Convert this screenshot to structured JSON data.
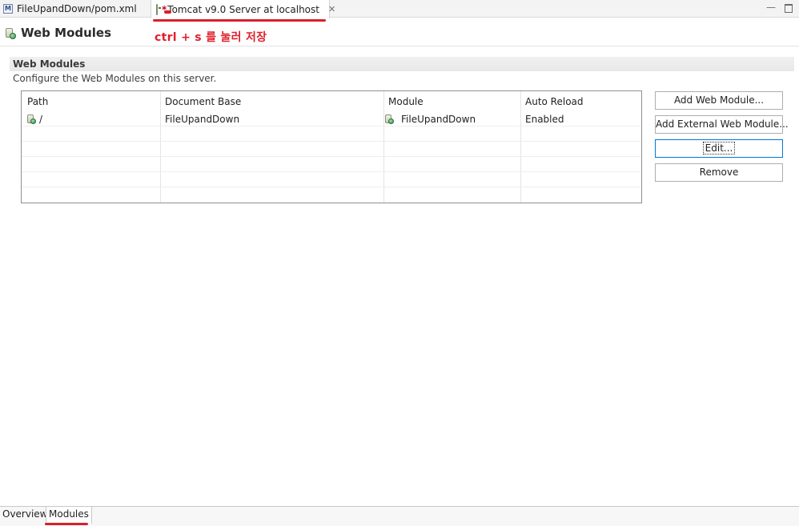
{
  "tabs": [
    {
      "label": "FileUpandDown/pom.xml",
      "icon": "maven-pom-icon",
      "dirty": false
    },
    {
      "label": "Tomcat v9.0 Server at localhost",
      "icon": "server-icon",
      "dirty_mark": "*",
      "active": true,
      "close": "✕"
    }
  ],
  "header": {
    "title": "Web Modules",
    "annotation": "ctrl + s 를 눌러 저장"
  },
  "section": {
    "title": "Web Modules",
    "description": "Configure the Web Modules on this server."
  },
  "table": {
    "columns": [
      "Path",
      "Document Base",
      "Module",
      "Auto Reload"
    ],
    "rows": [
      {
        "path": "/",
        "document_base": "FileUpandDown",
        "module": "FileUpandDown",
        "auto_reload": "Enabled"
      }
    ]
  },
  "buttons": {
    "add_web_module": "Add Web Module...",
    "add_external_web_module": "Add External Web Module...",
    "edit": "Edit...",
    "remove": "Remove"
  },
  "page_tabs": [
    "Overview",
    "Modules"
  ],
  "colors": {
    "annotation_red": "#e0202c",
    "focus_blue": "#0078d7"
  }
}
